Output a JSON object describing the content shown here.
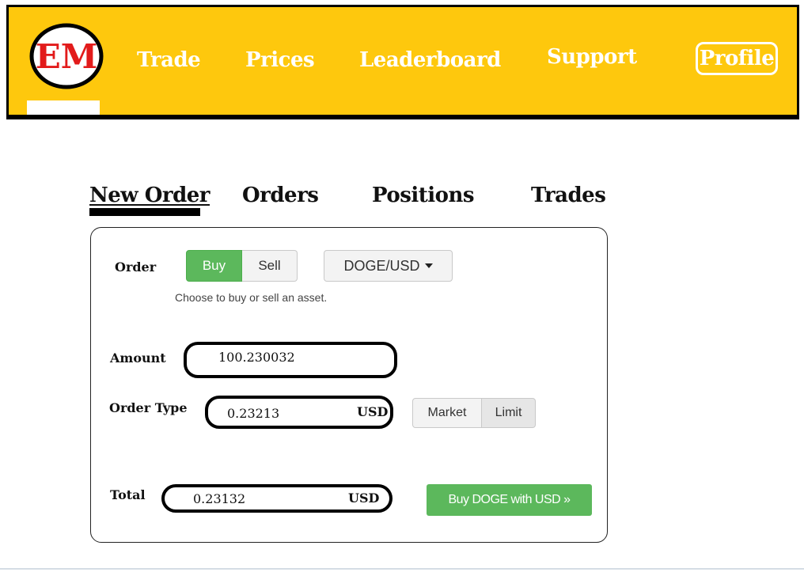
{
  "header": {
    "logo_text": "EM",
    "nav": [
      {
        "label": "Trade"
      },
      {
        "label": "Prices"
      },
      {
        "label": "Leaderboard"
      },
      {
        "label": "Support"
      }
    ],
    "profile_label": "Profile",
    "colors": {
      "background": "#fec80d",
      "text": "#ffffff",
      "logo_red": "#e21b1b"
    }
  },
  "tabs": [
    {
      "label": "New Order",
      "active": true
    },
    {
      "label": "Orders",
      "active": false
    },
    {
      "label": "Positions",
      "active": false
    },
    {
      "label": "Trades",
      "active": false
    }
  ],
  "order_form": {
    "order_label": "Order",
    "side_buttons": {
      "buy": "Buy",
      "sell": "Sell",
      "selected": "Buy"
    },
    "pair_select": {
      "value": "DOGE/USD"
    },
    "help_text": "Choose to buy or sell an asset.",
    "amount": {
      "label": "Amount",
      "value": "100.230032"
    },
    "order_type": {
      "label": "Order Type",
      "value": "0.23213",
      "unit": "USD",
      "options": {
        "market": "Market",
        "limit": "Limit",
        "selected": "Limit"
      }
    },
    "total": {
      "label": "Total",
      "value": "0.23132",
      "unit": "USD"
    },
    "submit_label": "Buy DOGE with USD »",
    "colors": {
      "buy_green": "#5cb85c"
    }
  }
}
